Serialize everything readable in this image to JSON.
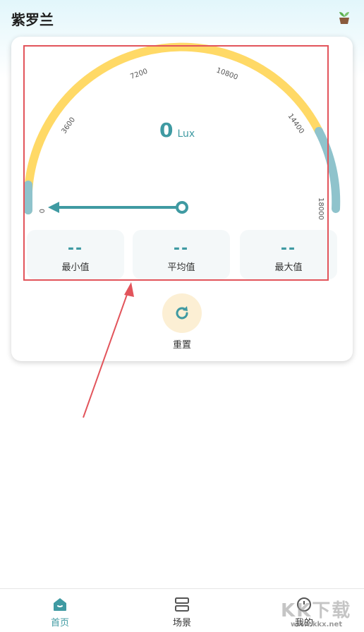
{
  "header": {
    "title": "紫罗兰",
    "icon": "plant-pot-icon"
  },
  "gauge": {
    "value": "0",
    "unit": "Lux",
    "min": 0,
    "max": 18000,
    "ticks": [
      "0",
      "3600",
      "7200",
      "10800",
      "14400",
      "18000"
    ],
    "colors": {
      "arc_main": "#ffd966",
      "arc_end": "#8fc3cc",
      "needle": "#3f9aa2"
    }
  },
  "stats": [
    {
      "value": "--",
      "label": "最小值"
    },
    {
      "value": "--",
      "label": "平均值"
    },
    {
      "value": "--",
      "label": "最大值"
    }
  ],
  "reset": {
    "label": "重置",
    "icon": "refresh-icon"
  },
  "tabs": [
    {
      "label": "首页",
      "icon": "home-icon",
      "active": true
    },
    {
      "label": "场景",
      "icon": "scenes-icon",
      "active": false
    },
    {
      "label": "我的",
      "icon": "profile-icon",
      "active": false
    }
  ],
  "watermark": {
    "text": "KK下载",
    "url": "www.kkx.net"
  }
}
